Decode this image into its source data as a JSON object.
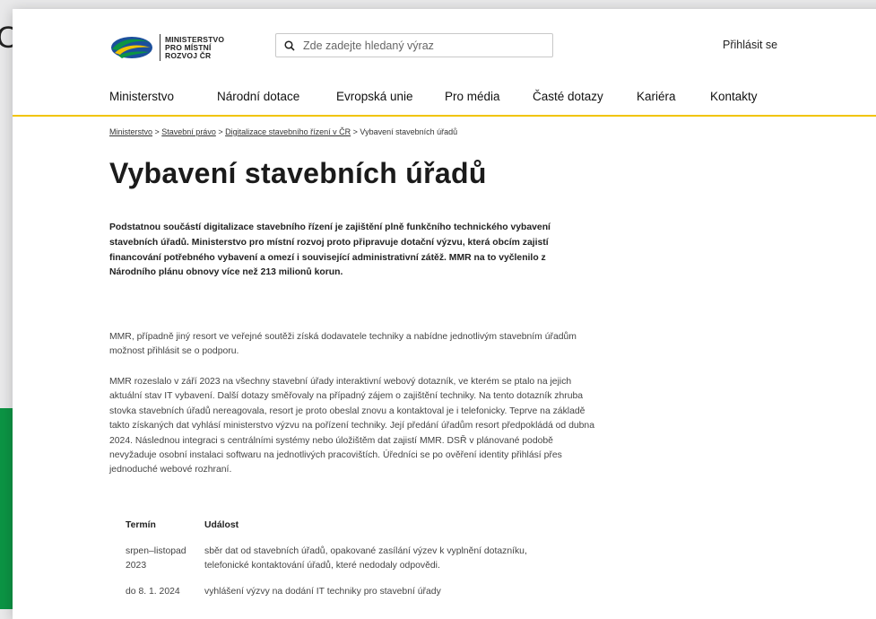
{
  "background": {
    "letter": "O",
    "accent_color": "#0c9444"
  },
  "header": {
    "logo": {
      "lines": [
        "MINISTERSTVO",
        "PRO MÍSTNÍ",
        "ROZVOJ ČR"
      ],
      "colors": {
        "green": "#0c9444",
        "yellow": "#f1c400",
        "blue": "#1b4f9c"
      }
    },
    "search": {
      "placeholder": "Zde zadejte hledaný výraz",
      "icon": "search-icon"
    },
    "login_label": "Přihlásit se"
  },
  "nav": {
    "items": [
      {
        "label": "Ministerstvo"
      },
      {
        "label": "Národní dotace"
      },
      {
        "label": "Evropská unie"
      },
      {
        "label": "Pro média"
      },
      {
        "label": "Časté dotazy"
      },
      {
        "label": "Kariéra"
      },
      {
        "label": "Kontakty"
      }
    ],
    "underline_color": "#f1c400"
  },
  "breadcrumb": {
    "items": [
      "Ministerstvo",
      "Stavební právo",
      "Digitalizace stavebního řízení v ČR"
    ],
    "separator": " > ",
    "current": "Vybavení stavebních úřadů"
  },
  "page_title": "Vybavení stavebních úřadů",
  "lead": "Podstatnou součástí digitalizace stavebního řízení je zajištění plně funkčního technického vybavení stavebních úřadů. Ministerstvo pro místní rozvoj proto připravuje dotační výzvu, která obcím zajistí financování potřebného vybavení a omezí i související administrativní zátěž. MMR na to vyčlenilo z Národního plánu obnovy více než 213 milionů korun.",
  "paragraphs": [
    "MMR, případně jiný resort ve veřejné soutěži získá dodavatele techniky a nabídne jednotlivým stavebním úřadům možnost přihlásit se o podporu.",
    "MMR rozeslalo v září 2023 na všechny stavební úřady interaktivní webový dotazník, ve kterém se ptalo na jejich aktuální stav IT vybavení. Další dotazy směřovaly na případný zájem o zajištění techniky. Na tento dotazník zhruba stovka stavebních úřadů nereagovala, resort je proto obeslal znovu a kontaktoval je i telefonicky. Teprve na základě takto získaných dat vyhlásí ministerstvo výzvu na pořízení techniky. Její předání úřadům resort předpokládá od dubna 2024. Následnou integraci s centrálními systémy nebo úložištěm dat zajistí MMR. DSŘ v plánované podobě nevyžaduje osobní instalaci softwaru na jednotlivých pracovištích. Úředníci se po ověření identity přihlásí přes jednoduché webové rozhraní."
  ],
  "timeline": {
    "headers": [
      "Termín",
      "Událost"
    ],
    "rows": [
      [
        "srpen–listopad 2023",
        "sběr dat od stavebních úřadů, opakované zasílání výzev k vyplnění dotazníku, telefonické kontaktování úřadů, které nedodaly odpovědi."
      ],
      [
        "do 8. 1. 2024",
        "vyhlášení výzvy na dodání IT techniky pro stavební úřady"
      ]
    ]
  }
}
